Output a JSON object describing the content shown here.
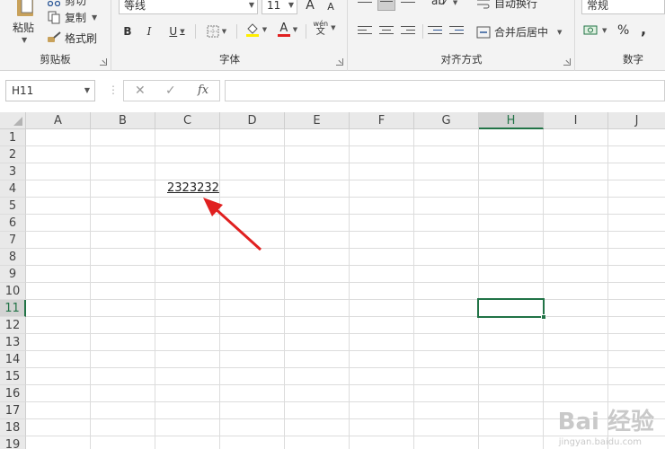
{
  "ribbon": {
    "clipboard": {
      "label": "剪贴板",
      "paste_label": "粘贴",
      "cut_label": "剪切",
      "copy_label": "复制",
      "format_painter_label": "格式刷"
    },
    "font": {
      "label": "字体",
      "font_name": "等线",
      "font_size": "11",
      "bold": "B",
      "italic": "I",
      "underline": "U",
      "grow": "A",
      "shrink": "A",
      "phonetic_top": "wén",
      "phonetic_bottom": "文",
      "font_color_letter": "A"
    },
    "alignment": {
      "label": "对齐方式",
      "wrap_text_label": "自动换行",
      "merge_center_label": "合并后居中"
    },
    "number": {
      "label": "数字",
      "format": "常规",
      "percent": "%",
      "comma": ","
    }
  },
  "formula_bar": {
    "name_box": "H11",
    "cancel": "✕",
    "enter": "✓",
    "fx": "fx",
    "content": ""
  },
  "sheet": {
    "columns": [
      "A",
      "B",
      "C",
      "D",
      "E",
      "F",
      "G",
      "H",
      "I",
      "J"
    ],
    "rows": [
      "1",
      "2",
      "3",
      "4",
      "5",
      "6",
      "7",
      "8",
      "9",
      "10",
      "11",
      "12",
      "13",
      "14",
      "15",
      "16",
      "17",
      "18",
      "19"
    ],
    "active_column": "H",
    "active_row": "11",
    "cells": {
      "C4": "2323232"
    }
  },
  "watermark": {
    "brand": "Bai 经验",
    "url": "jingyan.baidu.com"
  },
  "colors": {
    "accent": "#217346",
    "arrow": "#e02020",
    "font_color_bar": "#e02020",
    "fill_color_bar": "#ffee00"
  }
}
